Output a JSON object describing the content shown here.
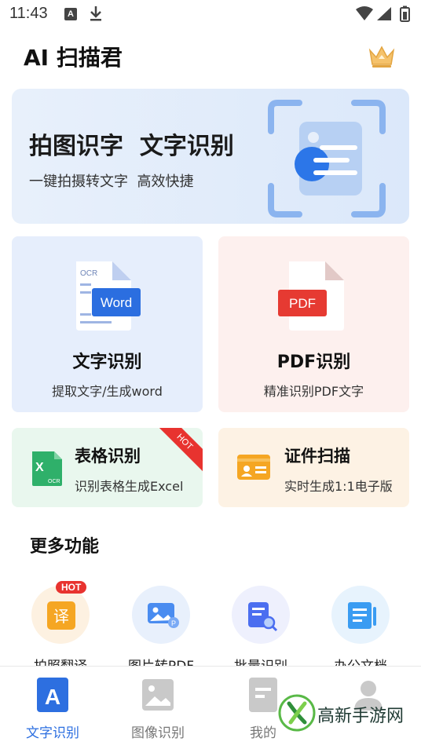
{
  "status_bar": {
    "time": "11:43",
    "notif_a": "A"
  },
  "header": {
    "title": "AI 扫描君",
    "crown_icon": "crown-icon"
  },
  "banner": {
    "title": "拍图识字  文字识别",
    "subtitle": "一键拍摄转文字  高效快捷",
    "illustration": "ocr-scan-illustration"
  },
  "cards": {
    "word": {
      "title": "文字识别",
      "subtitle": "提取文字/生成word",
      "icon_label": "Word",
      "icon_tag": "OCR"
    },
    "pdf": {
      "title": "PDF识别",
      "subtitle": "精准识别PDF文字",
      "icon_label": "PDF"
    },
    "excel": {
      "title": "表格识别",
      "subtitle": "识别表格生成Excel",
      "badge": "HOT",
      "icon_tag": "OCR"
    },
    "id": {
      "title": "证件扫描",
      "subtitle": "实时生成1:1电子版"
    }
  },
  "more": {
    "title": "更多功能",
    "items": [
      {
        "label": "拍照翻译",
        "icon": "translate-icon",
        "badge": "HOT",
        "glyph": "译"
      },
      {
        "label": "图片转PDF",
        "icon": "image-pdf-icon"
      },
      {
        "label": "批量识别",
        "icon": "batch-scan-icon"
      },
      {
        "label": "办公文档",
        "icon": "office-doc-icon"
      }
    ]
  },
  "bottom_nav": [
    {
      "label": "文字识别",
      "icon": "text-recognition-icon",
      "active": true
    },
    {
      "label": "图像识别",
      "icon": "image-recognition-icon",
      "active": false
    },
    {
      "label": "我的",
      "icon": "document-icon",
      "active": false
    },
    {
      "label": "",
      "icon": "profile-icon",
      "active": false
    }
  ],
  "watermark": {
    "text": "高新手游网"
  },
  "colors": {
    "accent": "#2d6fe0",
    "hot": "#e8332f",
    "word_bg": "#e6eefc",
    "pdf_bg": "#fdf0ee",
    "excel_bg": "#e9f7ee",
    "id_bg": "#fdf2e4"
  }
}
